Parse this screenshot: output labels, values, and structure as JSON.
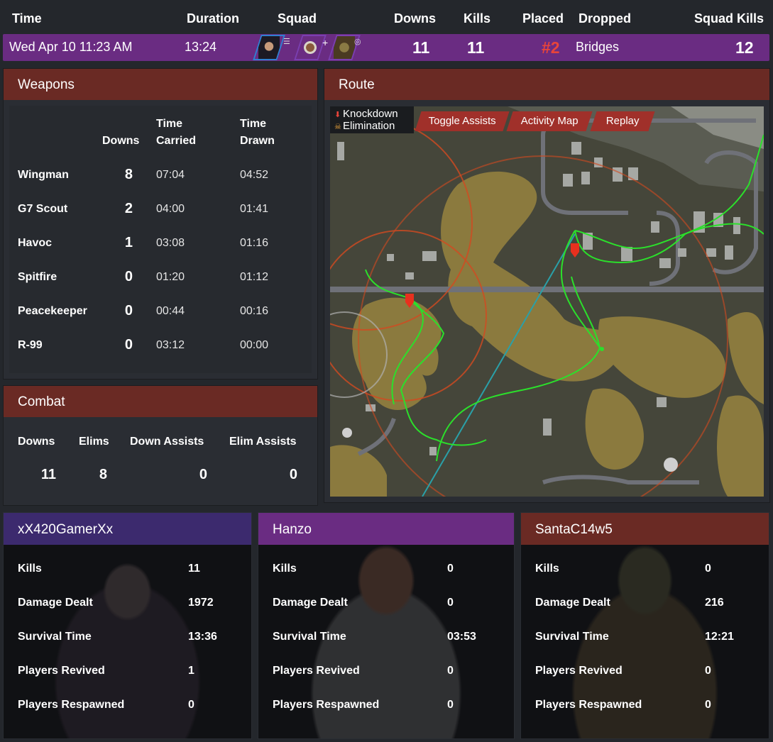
{
  "header": {
    "time": "Time",
    "duration": "Duration",
    "squad": "Squad",
    "downs": "Downs",
    "kills": "Kills",
    "placed": "Placed",
    "dropped": "Dropped",
    "squad_kills": "Squad Kills"
  },
  "match": {
    "time": "Wed Apr 10 11:23 AM",
    "duration": "13:24",
    "squad_icons": [
      "wraith-portrait-icon",
      "lifeline-portrait-icon",
      "bloodhound-portrait-icon"
    ],
    "downs": "11",
    "kills": "11",
    "placed": "#2",
    "dropped": "Bridges",
    "squad_kills": "12"
  },
  "weapons": {
    "title": "Weapons",
    "col_downs": "Downs",
    "col_carried_1": "Time",
    "col_carried_2": "Carried",
    "col_drawn_1": "Time",
    "col_drawn_2": "Drawn",
    "rows": [
      {
        "name": "Wingman",
        "downs": "8",
        "carried": "07:04",
        "drawn": "04:52"
      },
      {
        "name": "G7 Scout",
        "downs": "2",
        "carried": "04:00",
        "drawn": "01:41"
      },
      {
        "name": "Havoc",
        "downs": "1",
        "carried": "03:08",
        "drawn": "01:16"
      },
      {
        "name": "Spitfire",
        "downs": "0",
        "carried": "01:20",
        "drawn": "01:12"
      },
      {
        "name": "Peacekeeper",
        "downs": "0",
        "carried": "00:44",
        "drawn": "00:16"
      },
      {
        "name": "R-99",
        "downs": "0",
        "carried": "03:12",
        "drawn": "00:00"
      }
    ]
  },
  "combat": {
    "title": "Combat",
    "downs_label": "Downs",
    "elims_label": "Elims",
    "down_assists_label": "Down Assists",
    "elim_assists_label": "Elim Assists",
    "downs": "11",
    "elims": "8",
    "down_assists": "0",
    "elim_assists": "0"
  },
  "route": {
    "title": "Route",
    "legend_knockdown": "Knockdown",
    "legend_elimination": "Elimination",
    "toggle_assists": "Toggle Assists",
    "activity_map": "Activity Map",
    "replay": "Replay"
  },
  "players": [
    {
      "name": "xX420GamerXx",
      "color": "#3c2a6e",
      "kills": "11",
      "damage": "1972",
      "survival": "13:36",
      "revived": "1",
      "respawned": "0"
    },
    {
      "name": "Hanzo",
      "color": "#6a2c82",
      "kills": "0",
      "damage": "0",
      "survival": "03:53",
      "revived": "0",
      "respawned": "0"
    },
    {
      "name": "SantaC14w5",
      "color": "#6a2a24",
      "kills": "0",
      "damage": "216",
      "survival": "12:21",
      "revived": "0",
      "respawned": "0"
    }
  ],
  "player_labels": {
    "kills": "Kills",
    "damage": "Damage Dealt",
    "survival": "Survival Time",
    "revived": "Players Revived",
    "respawned": "Players Respawned"
  }
}
